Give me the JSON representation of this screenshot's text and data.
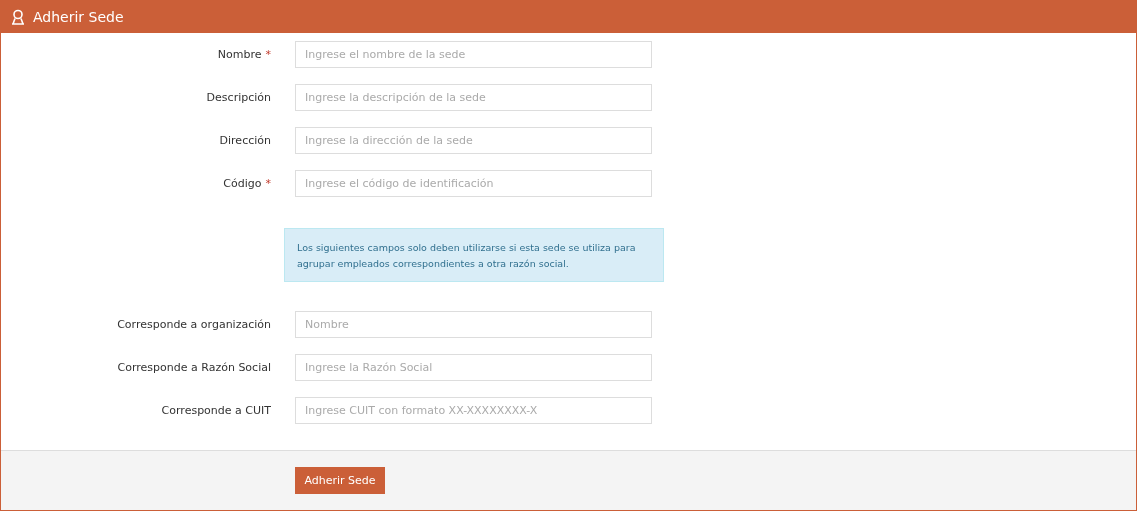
{
  "header": {
    "title": "Adherir Sede"
  },
  "fields": [
    {
      "label": "Nombre",
      "required_mark": "*",
      "placeholder": "Ingrese el nombre de la sede"
    },
    {
      "label": "Descripción",
      "placeholder": "Ingrese la descripción de la sede"
    },
    {
      "label": "Dirección",
      "placeholder": "Ingrese la dirección de la sede"
    },
    {
      "label": "Código",
      "required_mark": "*",
      "placeholder": "Ingrese el código de identificación"
    }
  ],
  "info_alert": "Los siguientes campos solo deben utilizarse si esta sede se utiliza para agrupar empleados correspondientes a otra razón social.",
  "extra_fields": [
    {
      "label": "Corresponde a organización",
      "placeholder": "Nombre"
    },
    {
      "label": "Corresponde a Razón Social",
      "placeholder": "Ingrese la Razón Social"
    },
    {
      "label": "Corresponde a CUIT",
      "placeholder": "Ingrese CUIT con formato XX-XXXXXXXX-X"
    }
  ],
  "submit_button": "Adherir Sede"
}
